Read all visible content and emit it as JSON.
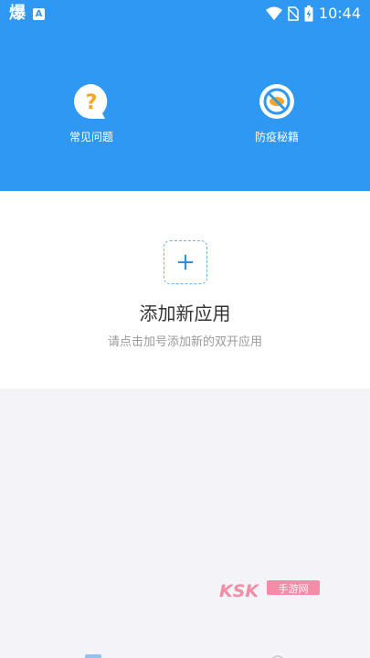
{
  "status_bar": {
    "app_glyph": "爆",
    "notification_badge": "A",
    "time": "10:44",
    "icons": [
      "wifi-icon",
      "no-sim-icon",
      "battery-charging-icon"
    ]
  },
  "header": {
    "color": "#2f98f2",
    "actions": [
      {
        "label": "常见问题",
        "icon": "question-bubble-icon"
      },
      {
        "label": "防疫秘籍",
        "icon": "no-virus-icon"
      }
    ]
  },
  "add_app": {
    "plus": "+",
    "title": "添加新应用",
    "hint": "请点击加号添加新的双开应用"
  },
  "watermark": {
    "brand": "KSK",
    "text": "手游网"
  },
  "bottom_nav": {
    "icons": [
      "home-tab-icon",
      "profile-tab-icon"
    ]
  }
}
